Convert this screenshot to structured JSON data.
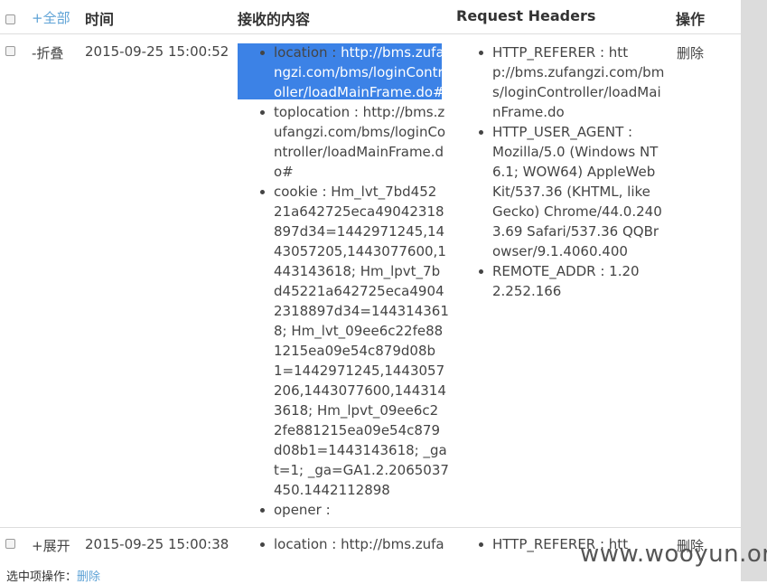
{
  "header": {
    "expand_all": "+全部",
    "col_time": "时间",
    "col_content": "接收的内容",
    "col_headers": "Request Headers",
    "col_action": "操作"
  },
  "row1": {
    "toggle": "-折叠",
    "time": "2015-09-25 15:00:52",
    "delete": "删除",
    "content": [
      {
        "lines": [
          "location : http://bms.zufa",
          "ngzi.com/bms/loginContr",
          "oller/loadMainFrame.do#"
        ]
      },
      {
        "lines": [
          "toplocation : http://bms.z",
          "ufangzi.com/bms/loginCo",
          "ntroller/loadMainFrame.d",
          "o#"
        ]
      },
      {
        "lines": [
          "cookie : Hm_lvt_7bd452",
          "21a642725eca49042318",
          "897d34=1442971245,14",
          "43057205,1443077600,1",
          "443143618; Hm_lpvt_7b",
          "d45221a642725eca4904",
          "2318897d34=144314361",
          "8; Hm_lvt_09ee6c22fe88",
          "1215ea09e54c879d08b",
          "1=1442971245,1443057",
          "206,1443077600,144314",
          "3618; Hm_lpvt_09ee6c2",
          "2fe881215ea09e54c879",
          "d08b1=1443143618; _ga",
          "t=1; _ga=GA1.2.2065037",
          "450.1442112898"
        ]
      },
      {
        "lines": [
          "opener :"
        ]
      }
    ],
    "headers": [
      {
        "lines": [
          "HTTP_REFERER : htt",
          "p://bms.zufangzi.com/bm",
          "s/loginController/loadMai",
          "nFrame.do"
        ]
      },
      {
        "lines": [
          "HTTP_USER_AGENT :",
          "Mozilla/5.0 (Windows NT",
          "6.1; WOW64) AppleWeb",
          "Kit/537.36 (KHTML, like",
          "Gecko) Chrome/44.0.240",
          "3.69 Safari/537.36 QQBr",
          "owser/9.1.4060.400"
        ]
      },
      {
        "lines": [
          "REMOTE_ADDR : 1.20",
          "2.252.166"
        ]
      }
    ]
  },
  "row2": {
    "toggle": "+展开",
    "time": "2015-09-25 15:00:38",
    "content_first": "location : http://bms.zufa",
    "headers_first": "HTTP_REFERER : htt",
    "delete": "删除"
  },
  "footer": {
    "label": "选中项操作：",
    "delete": "删除"
  },
  "watermark": "www.wooyun.org"
}
